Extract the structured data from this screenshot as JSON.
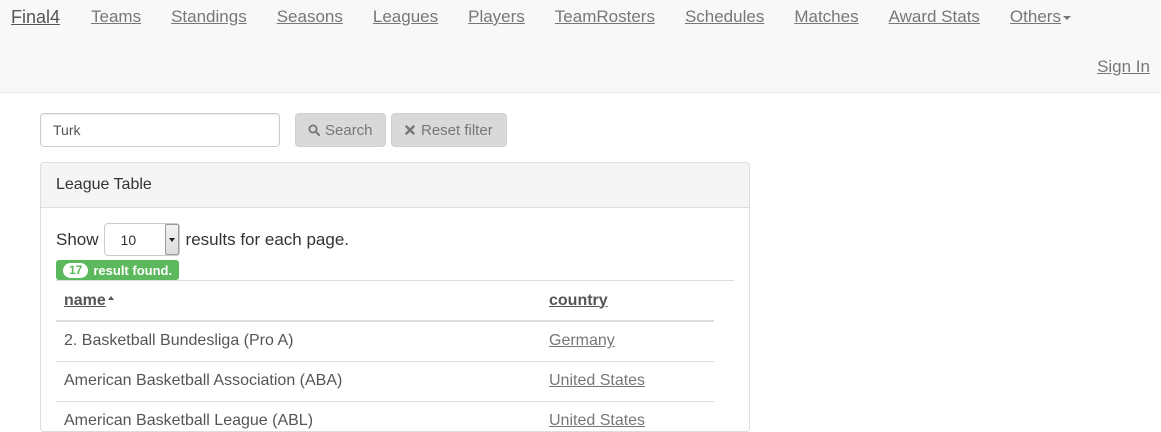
{
  "navbar": {
    "brand": "Final4",
    "items": [
      {
        "label": "Teams",
        "name": "nav-teams"
      },
      {
        "label": "Standings",
        "name": "nav-standings"
      },
      {
        "label": "Seasons",
        "name": "nav-seasons"
      },
      {
        "label": "Leagues",
        "name": "nav-leagues"
      },
      {
        "label": "Players",
        "name": "nav-players"
      },
      {
        "label": "TeamRosters",
        "name": "nav-teamrosters"
      },
      {
        "label": "Schedules",
        "name": "nav-schedules"
      },
      {
        "label": "Matches",
        "name": "nav-matches"
      },
      {
        "label": "Award Stats",
        "name": "nav-award-stats"
      },
      {
        "label": "Others",
        "name": "nav-others"
      }
    ],
    "sign_in": "Sign In"
  },
  "filter": {
    "search_value": "Turk",
    "search_label": "Search",
    "search_icon": "search-icon",
    "reset_label": "Reset filter",
    "reset_icon": "close-icon"
  },
  "panel": {
    "title": "League Table",
    "show_prefix": "Show",
    "page_size": "10",
    "show_suffix": "results for each page.",
    "result_count": "17",
    "result_text": "result found."
  },
  "table": {
    "headers": {
      "name": "name",
      "country": "country"
    },
    "sort_column": "name",
    "sort_direction": "ascending",
    "rows": [
      {
        "name": "2. Basketball Bundesliga (Pro A)",
        "country": "Germany"
      },
      {
        "name": "American Basketball Association (ABA)",
        "country": "United States"
      },
      {
        "name": "American Basketball League (ABL)",
        "country": "United States"
      }
    ]
  },
  "colors": {
    "navbar_bg": "#f8f8f8",
    "badge_green": "#5cb85c",
    "button_gray": "#d9d9d9"
  }
}
